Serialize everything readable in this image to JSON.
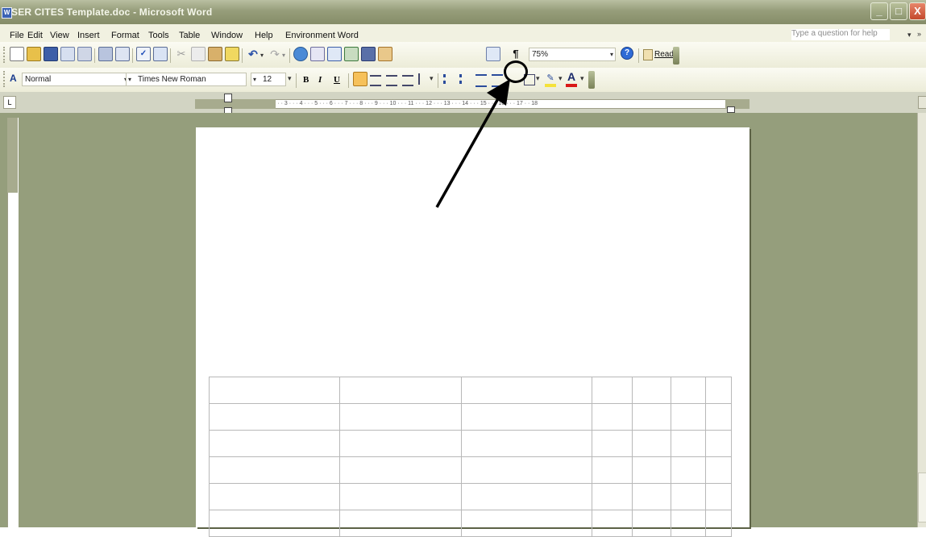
{
  "window": {
    "title": "SER CITES Template.doc - Microsoft Word",
    "app_icon": "W"
  },
  "window_controls": {
    "minimize": "_",
    "maximize": "□",
    "close": "X"
  },
  "menubar": {
    "items": [
      "File",
      "Edit",
      "View",
      "Insert",
      "Format",
      "Tools",
      "Table",
      "Window",
      "Help",
      "Environment Word"
    ],
    "help_placeholder": "Type a question for help",
    "help_dropdown": "▾",
    "overflow": "»"
  },
  "standard_toolbar": {
    "icons": [
      "new-icon",
      "open-icon",
      "save-icon",
      "permission-icon",
      "print-icon",
      "print-preview-icon",
      "spelling-icon",
      "research-icon",
      "cut-icon",
      "copy-icon",
      "paste-icon",
      "format-painter-icon",
      "undo-icon",
      "redo-icon",
      "hyperlink-icon",
      "tables-borders-icon",
      "insert-table-icon",
      "excel-icon",
      "columns-icon",
      "drawing-icon",
      "document-map-icon",
      "show-hide-icon",
      "help-icon"
    ],
    "show_hide_glyph": "¶",
    "zoom": "75%",
    "read_label": "Read"
  },
  "formatting_toolbar": {
    "style": "Normal",
    "font": "Times New Roman",
    "font_size": "12",
    "bold": "B",
    "italic": "I",
    "underline": "U",
    "font_color_glyph": "A"
  },
  "ruler": {
    "text": "3 · · · 2 · · · 1 · · · | · · · 1 · · · 2 · · · 3 · · · 4 · · · 5 · · · 6 · · · 7 · · · 8 · · · 9 · · · 10 · · · 11 · · · 12 · · · 13 · · · 14 · · · 15 · · · 16 · · · 17 · · 18"
  },
  "colors": {
    "titlebar": "#8c9370",
    "workspace": "#959e7c",
    "menubar": "#f1f1e1",
    "annotation": "#000000"
  },
  "document_table": {
    "rows": 6,
    "columns": 7
  }
}
